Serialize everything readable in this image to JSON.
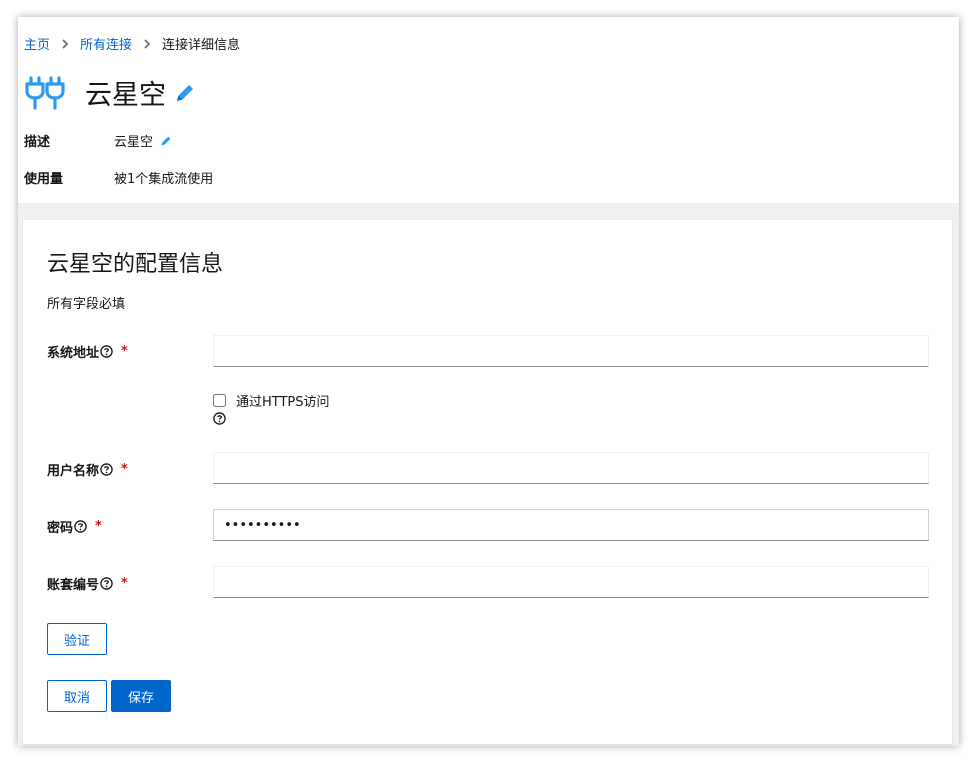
{
  "breadcrumb": {
    "home": "主页",
    "all_connections": "所有连接",
    "current": "连接详细信息"
  },
  "connection": {
    "name": "云星空",
    "icon": "connector-plug-icon"
  },
  "meta": {
    "description_label": "描述",
    "description_value": "云星空",
    "usage_label": "使用量",
    "usage_value": "被1个集成流使用"
  },
  "config": {
    "title": "云星空的配置信息",
    "subtitle": "所有字段必填",
    "required_mark": "*",
    "fields": {
      "system_address": {
        "label": "系统地址",
        "value": ""
      },
      "https_checkbox": {
        "label": "通过HTTPS访问",
        "checked": false
      },
      "username": {
        "label": "用户名称",
        "value": ""
      },
      "password": {
        "label": "密码",
        "value": "••••••••••"
      },
      "account_number": {
        "label": "账套编号",
        "value": ""
      }
    },
    "verify_button": "验证",
    "cancel_button": "取消",
    "save_button": "保存"
  },
  "colors": {
    "accent": "#0066cc",
    "required": "#c9190b",
    "icon_blue": "#2b9af3"
  }
}
